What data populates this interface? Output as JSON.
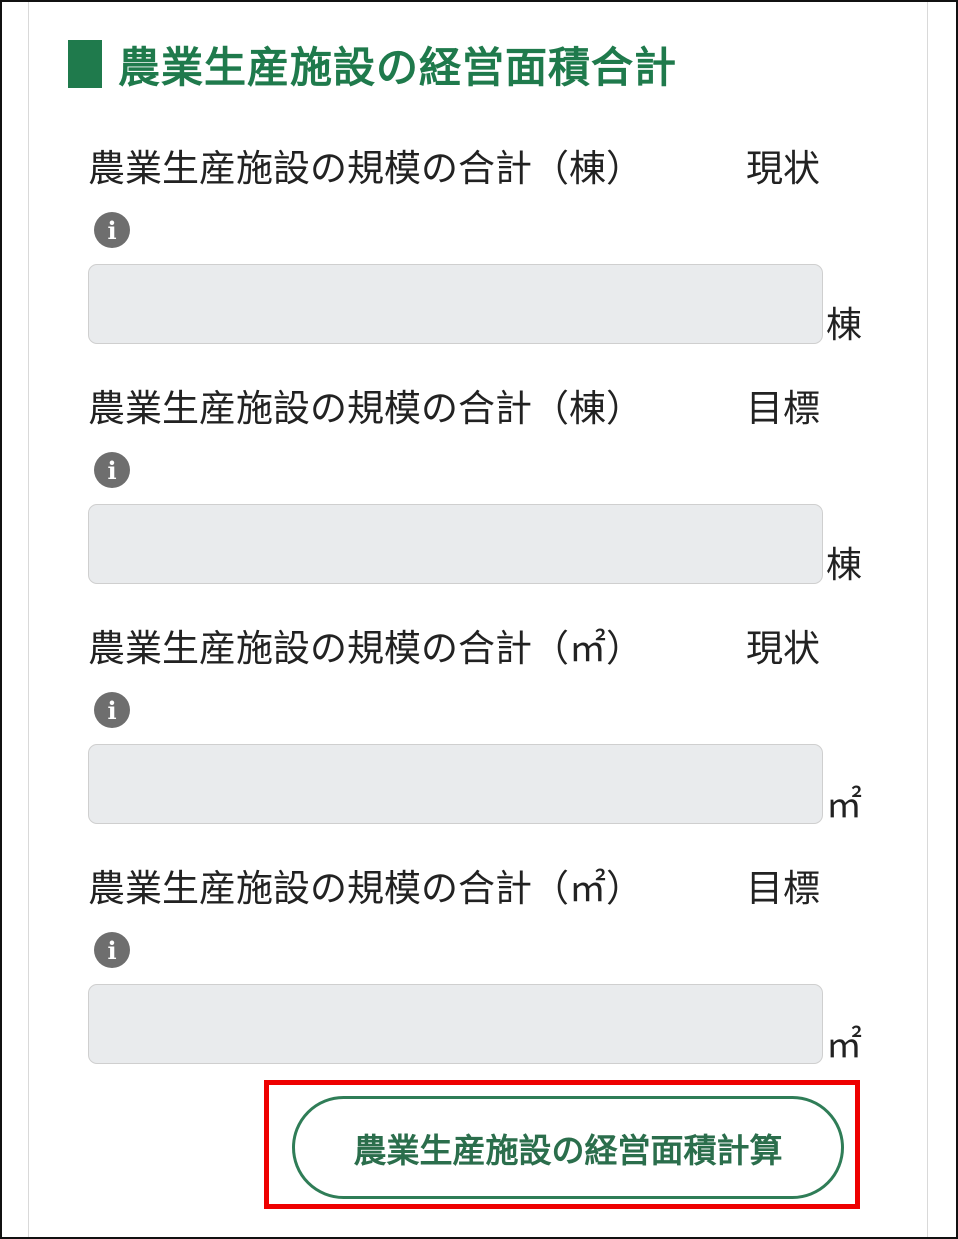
{
  "section": {
    "title": "農業生産施設の経営面積合計"
  },
  "fields": [
    {
      "label": "農業生産施設の規模の合計（棟）",
      "status": "現状",
      "value": "",
      "unit": "棟",
      "info_icon": "info-icon"
    },
    {
      "label": "農業生産施設の規模の合計（棟）",
      "status": "目標",
      "value": "",
      "unit": "棟",
      "info_icon": "info-icon"
    },
    {
      "label": "農業生産施設の規模の合計（㎡）",
      "status": "現状",
      "value": "",
      "unit": "㎡",
      "info_icon": "info-icon"
    },
    {
      "label": "農業生産施設の規模の合計（㎡）",
      "status": "目標",
      "value": "",
      "unit": "㎡",
      "info_icon": "info-icon"
    }
  ],
  "calc_button": {
    "label": "農業生産施設の経営面積計算"
  },
  "colors": {
    "accent_green": "#1f7a4c",
    "highlight_red": "#ee0000",
    "input_bg": "#e9ebed"
  }
}
